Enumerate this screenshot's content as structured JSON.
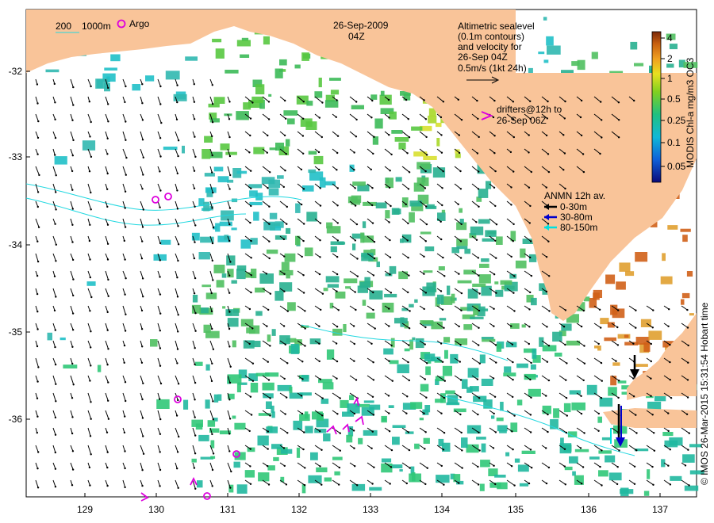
{
  "title": {
    "date": "26-Sep-2009",
    "time": "04Z"
  },
  "legend_depth": {
    "contour_200": "200",
    "contour_1000": "1000m"
  },
  "argo_label": "Argo",
  "altimetry_note": [
    "Altimetric sealevel",
    "(0.1m contours)",
    "and velocity for",
    "26-Sep 04Z",
    "0.5m/s (1kt 24h)"
  ],
  "drifters_note": [
    "drifters@12h to",
    "26-Sep 06Z"
  ],
  "anmn_legend": {
    "title": "ANMN 12h av.",
    "items": [
      {
        "label": "0-30m",
        "color": "#000000"
      },
      {
        "label": "30-80m",
        "color": "#0000cc"
      },
      {
        "label": "80-150m",
        "color": "#00e0e0"
      }
    ]
  },
  "colorbar": {
    "label": "MODIS Chl-a mg/m3 OC3",
    "ticks": [
      "4",
      "2",
      "1",
      "0.5",
      "0.25",
      "0.1",
      "0.05"
    ]
  },
  "credit": "© IMOS 26-Mar-2015 15:31:54 Hobart time",
  "axes": {
    "x_ticks": [
      "129",
      "130",
      "131",
      "132",
      "133",
      "134",
      "135",
      "136",
      "137"
    ],
    "y_ticks": [
      "-32",
      "-33",
      "-34",
      "-35",
      "-36"
    ]
  },
  "colors": {
    "land": "#f9c499",
    "argo": "#dd00dd",
    "contour": "#00dddd",
    "bg": "#ffffff"
  }
}
